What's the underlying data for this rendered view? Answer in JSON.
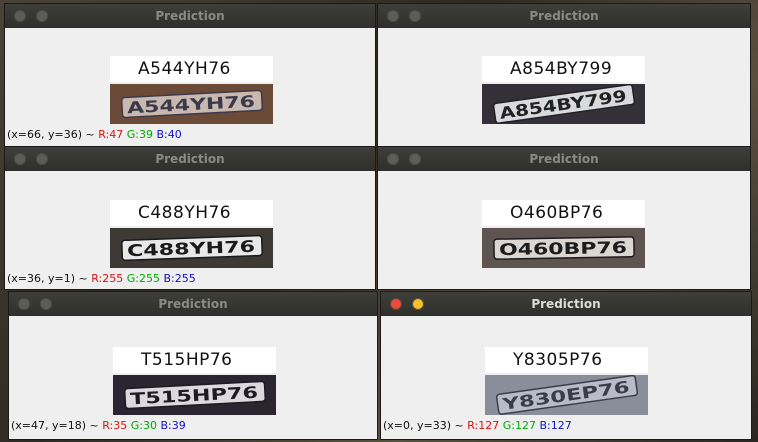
{
  "windows": [
    {
      "title": "Prediction",
      "prediction": "A544YH76",
      "plate_text": "A544YH76",
      "plate_colors": {
        "bg": "#6b4a38",
        "plate": "#c9b8b0",
        "text": "#3a3a4a"
      },
      "status": {
        "coords": "(x=66, y=36) ~",
        "r": "R:47",
        "g": "G:39",
        "b": "B:40"
      }
    },
    {
      "title": "Prediction",
      "prediction": "A854BY799",
      "plate_text": "A854BY799",
      "plate_colors": {
        "bg": "#34303a",
        "plate": "#d9d9e0",
        "text": "#222"
      }
    },
    {
      "title": "Prediction",
      "prediction": "C488YH76",
      "plate_text": "C488YH76",
      "plate_colors": {
        "bg": "#3d3a36",
        "plate": "#e8e8e8",
        "text": "#1a1a1a"
      },
      "status": {
        "coords": "(x=36, y=1) ~",
        "r": "R:255",
        "g": "G:255",
        "b": "B:255"
      }
    },
    {
      "title": "Prediction",
      "prediction": "O460BP76",
      "plate_text": "O460BP76",
      "plate_colors": {
        "bg": "#5e5552",
        "plate": "#dcd6d2",
        "text": "#1c1c1c"
      }
    },
    {
      "title": "Prediction",
      "prediction": "T515HP76",
      "plate_text": "T515HP76",
      "plate_colors": {
        "bg": "#2a2530",
        "plate": "#dcd9de",
        "text": "#1d1a22"
      },
      "status": {
        "coords": "(x=47, y=18) ~",
        "r": "R:35",
        "g": "G:30",
        "b": "B:39"
      }
    },
    {
      "title": "Prediction",
      "prediction": "Y8305P76",
      "plate_text": "Y830EP76",
      "plate_colors": {
        "bg": "#8a8e9a",
        "plate": "#b9bcc6",
        "text": "#3a3d48"
      },
      "status": {
        "coords": "(x=0, y=33) ~",
        "r": "R:127",
        "g": "G:127",
        "b": "B:127"
      }
    }
  ]
}
